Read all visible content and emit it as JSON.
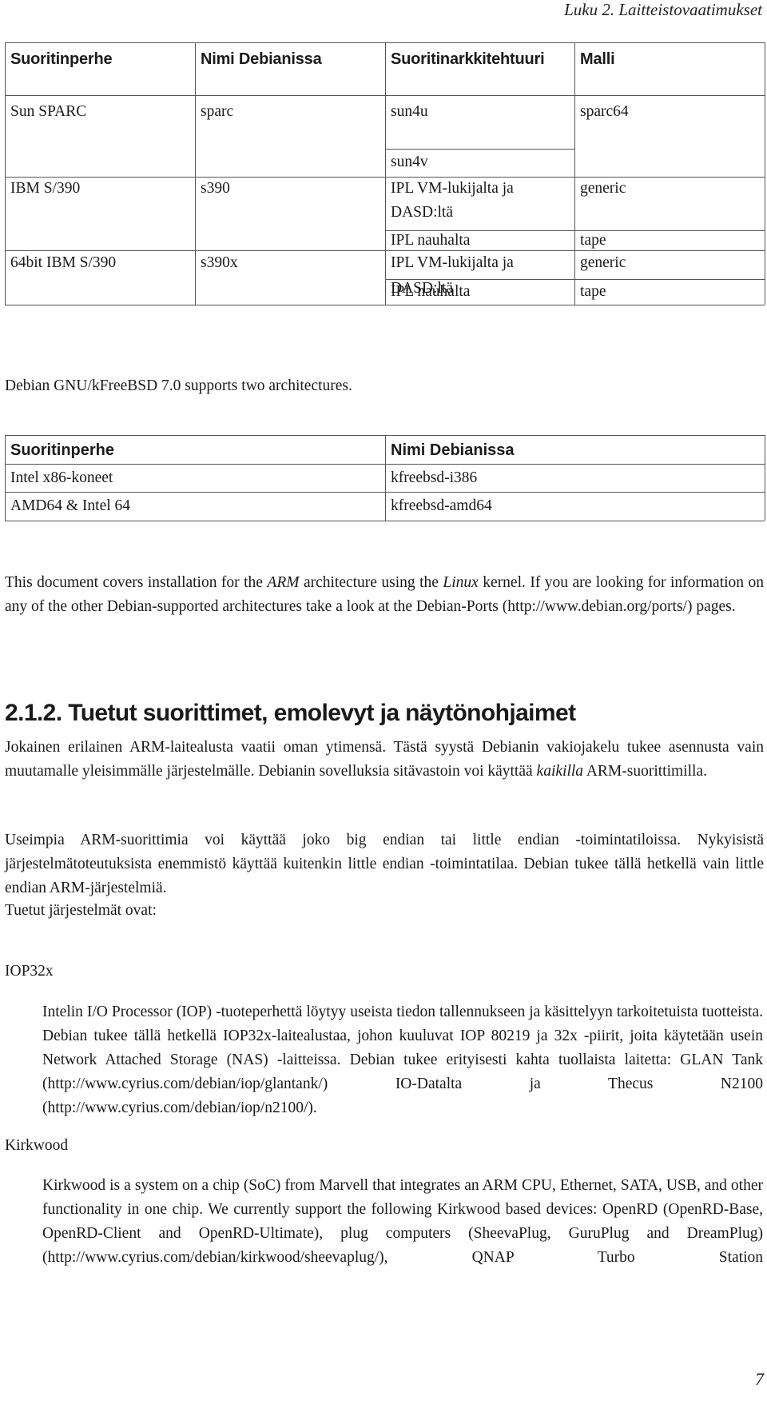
{
  "running_header": "Luku 2. Laitteistovaatimukset",
  "table1": {
    "headers": [
      "Suoritinperhe",
      "Nimi Debianissa",
      "Suoritinarkkitehtuuri",
      "Malli"
    ],
    "rows": [
      {
        "family": "Sun SPARC",
        "debian_name": "sparc",
        "subrows": [
          {
            "arch": "sun4u",
            "model": "sparc64"
          },
          {
            "arch": "sun4v",
            "model": ""
          }
        ]
      },
      {
        "family": "IBM S/390",
        "debian_name": "s390",
        "subrows": [
          {
            "arch": "IPL VM-lukijalta ja DASD:ltä",
            "model": "generic"
          },
          {
            "arch": "IPL nauhalta",
            "model": "tape"
          }
        ]
      },
      {
        "family": "64bit IBM S/390",
        "debian_name": "s390x",
        "subrows": [
          {
            "arch": "IPL VM-lukijalta ja DASD:ltä",
            "model": "generic"
          },
          {
            "arch": "IPL nauhalta",
            "model": "tape"
          }
        ]
      }
    ]
  },
  "kfreebsd_intro": "Debian GNU/kFreeBSD 7.0 supports two architectures.",
  "table2": {
    "headers": [
      "Suoritinperhe",
      "Nimi Debianissa"
    ],
    "rows": [
      [
        "Intel x86-koneet",
        "kfreebsd-i386"
      ],
      [
        "AMD64 & Intel 64",
        "kfreebsd-amd64"
      ]
    ]
  },
  "coverage_paragraph": {
    "part1": "This document covers installation for the ",
    "arch": "ARM",
    "part2": " architecture using the ",
    "kernel": "Linux",
    "part3": " kernel. If you are looking for information on any of the other Debian-supported architectures take a look at the Debian-Ports (http://www.debian.org/ports/) pages."
  },
  "section": {
    "heading": "2.1.2. Tuetut suorittimet, emolevyt ja näytönohjaimet",
    "p1_part1": "Jokainen erilainen ARM-laitealusta vaatii oman ytimensä. Tästä syystä Debianin vakiojakelu tukee asennusta vain muutamalle yleisimmälle järjestelmälle. Debianin sovelluksia sitävastoin voi käyttää ",
    "p1_emph": "kaikilla",
    "p1_part2": " ARM-suorittimilla.",
    "p2": "Useimpia ARM-suorittimia voi käyttää joko big endian tai little endian -toimintatiloissa. Nykyisistä järjestelmätoteutuksista enemmistö käyttää kuitenkin little endian -toimintatilaa. Debian tukee tällä hetkellä vain little endian ARM-järjestelmiä.",
    "p3": "Tuetut järjestelmät ovat:",
    "systems": [
      {
        "term": "IOP32x",
        "definition": "Intelin I/O Processor (IOP) -tuoteperhettä löytyy useista tiedon tallennukseen ja käsittelyyn tarkoitetuista tuotteista. Debian tukee tällä hetkellä IOP32x-laitealustaa, johon kuuluvat IOP 80219 ja 32x -piirit, joita käytetään usein Network Attached Storage (NAS) -laitteissa. Debian tukee erityisesti kahta tuollaista laitetta: GLAN Tank (http://www.cyrius.com/debian/iop/glantank/) IO-Datalta ja Thecus N2100 (http://www.cyrius.com/debian/iop/n2100/)."
      },
      {
        "term": "Kirkwood",
        "definition": "Kirkwood is a system on a chip (SoC) from Marvell that integrates an ARM CPU, Ethernet, SATA, USB, and other functionality in one chip. We currently support the following Kirkwood based devices: OpenRD (OpenRD-Base, OpenRD-Client and OpenRD-Ultimate), plug computers (SheevaPlug, GuruPlug and DreamPlug) (http://www.cyrius.com/debian/kirkwood/sheevaplug/), QNAP Turbo Station"
      }
    ]
  },
  "page_number": "7"
}
